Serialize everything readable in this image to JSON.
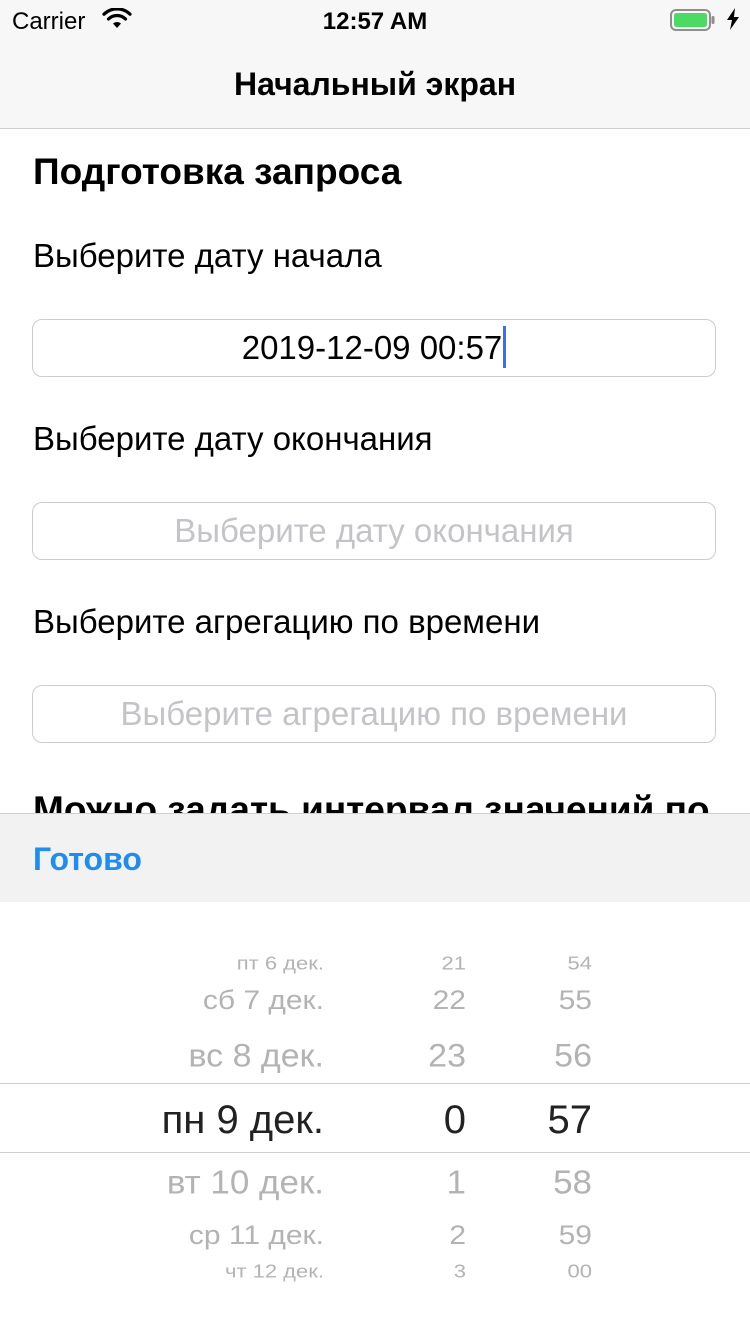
{
  "status_bar": {
    "carrier": "Carrier",
    "time": "12:57 AM",
    "battery_color": "#4cd964"
  },
  "nav": {
    "title": "Начальный экран"
  },
  "form": {
    "section_title": "Подготовка запроса",
    "start_label": "Выберите дату начала",
    "start_value": "2019-12-09 00:57",
    "end_label": "Выберите дату окончания",
    "end_placeholder": "Выберите дату окончания",
    "aggregation_label": "Выберите агрегацию по времени",
    "aggregation_placeholder": "Выберите агрегацию по времени",
    "cut_text": "Можно задать интервал значений по"
  },
  "toolbar": {
    "done_label": "Готово",
    "accent": "#1f8cf0"
  },
  "picker": {
    "days": [
      "пт 6 дек.",
      "сб 7 дек.",
      "вс 8 дек.",
      "пн 9 дек.",
      "вт 10 дек.",
      "ср 11 дек.",
      "чт 12 дек."
    ],
    "hours": [
      "21",
      "22",
      "23",
      "0",
      "1",
      "2",
      "3"
    ],
    "minutes": [
      "54",
      "55",
      "56",
      "57",
      "58",
      "59",
      "00"
    ],
    "selected_index": 3
  }
}
